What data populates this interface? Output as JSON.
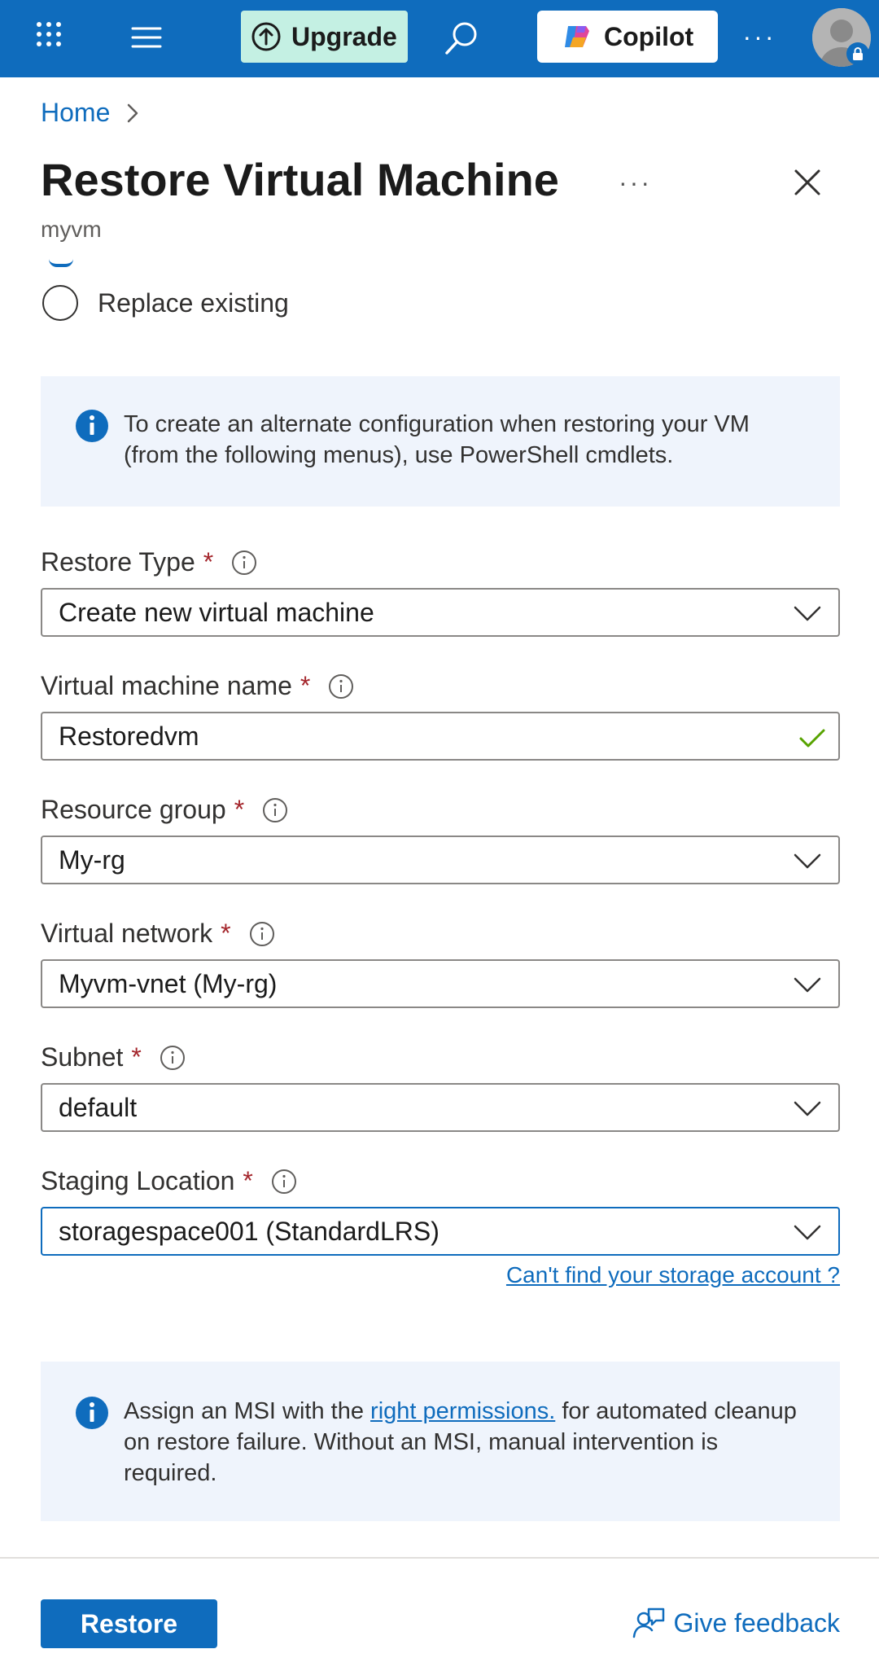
{
  "topbar": {
    "upgrade_label": "Upgrade",
    "copilot_label": "Copilot",
    "more_label": "···",
    "brand_color": "#0f6cbd"
  },
  "breadcrumb": {
    "home": "Home"
  },
  "page": {
    "title": "Restore Virtual Machine",
    "more_label": "···",
    "subtitle": "myvm"
  },
  "restore_option": {
    "label": "Replace existing"
  },
  "info_alt_config": "To create an alternate configuration when restoring your VM (from the following menus), use PowerShell cmdlets.",
  "fields": {
    "restore_type": {
      "label": "Restore Type",
      "required": "*",
      "value": "Create new virtual machine"
    },
    "vm_name": {
      "label": "Virtual machine name",
      "required": "*",
      "value": "Restoredvm"
    },
    "resource_group": {
      "label": "Resource group",
      "required": "*",
      "value": "My-rg"
    },
    "virtual_network": {
      "label": "Virtual network",
      "required": "*",
      "value": "Myvm-vnet (My-rg)"
    },
    "subnet": {
      "label": "Subnet",
      "required": "*",
      "value": "default"
    },
    "staging_location": {
      "label": "Staging Location",
      "required": "*",
      "value": "storagespace001 (StandardLRS)"
    }
  },
  "storage_link": "Can't find your storage account ?",
  "info_msi": {
    "before": "Assign an MSI with the ",
    "link": "right permissions.",
    "after": " for automated cleanup on restore failure. Without an MSI, manual intervention is required."
  },
  "footer": {
    "restore_label": "Restore",
    "feedback_label": "Give feedback"
  }
}
